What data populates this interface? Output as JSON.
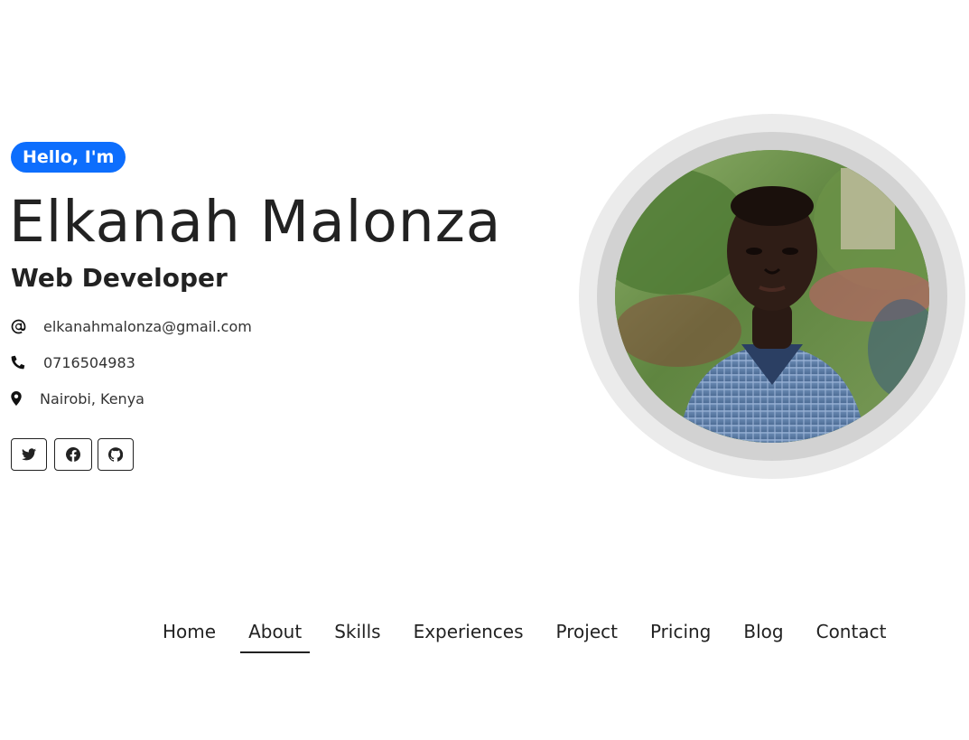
{
  "hero": {
    "greeting": "Hello, I'm",
    "name": "Elkanah Malonza",
    "role": "Web Developer",
    "contacts": {
      "email": {
        "icon": "at-icon",
        "value": "elkanahmalonza@gmail.com"
      },
      "phone": {
        "icon": "phone-icon",
        "value": "0716504983"
      },
      "location": {
        "icon": "map-pin-icon",
        "value": "Nairobi, Kenya"
      }
    },
    "socials": [
      {
        "icon": "twitter-icon"
      },
      {
        "icon": "facebook-icon"
      },
      {
        "icon": "github-icon"
      }
    ],
    "portrait": {
      "icon": "profile-photo"
    }
  },
  "colors": {
    "accent": "#0d6efd",
    "text": "#222222",
    "ring_outer": "#ebebeb",
    "ring_inner": "#d2d2d2"
  },
  "nav": {
    "items": [
      {
        "label": "Home"
      },
      {
        "label": "About",
        "active": true
      },
      {
        "label": "Skills"
      },
      {
        "label": "Experiences"
      },
      {
        "label": "Project"
      },
      {
        "label": "Pricing"
      },
      {
        "label": "Blog"
      },
      {
        "label": "Contact"
      }
    ]
  }
}
